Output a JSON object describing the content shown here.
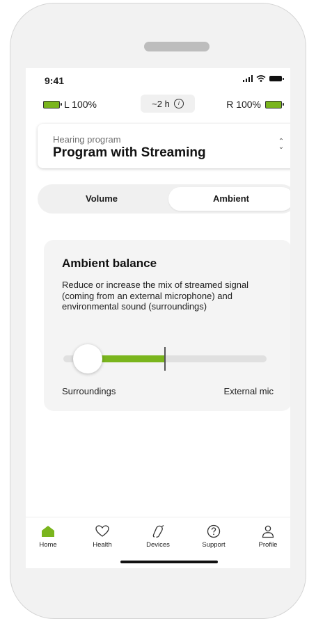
{
  "status_bar": {
    "time": "9:41"
  },
  "battery": {
    "left": "L 100%",
    "right": "R 100%",
    "duration": "~2 h"
  },
  "program": {
    "label": "Hearing program",
    "value": "Program with Streaming"
  },
  "tabs": [
    {
      "label": "Volume",
      "selected": false
    },
    {
      "label": "Ambient",
      "selected": true
    }
  ],
  "ambient": {
    "title": "Ambient balance",
    "description": "Reduce or increase the mix of streamed signal (coming from an external microphone) and environmental sound (surroundings)",
    "slider": {
      "min_label": "Surroundings",
      "max_label": "External mic",
      "value_fraction": 0.12
    }
  },
  "nav": [
    {
      "label": "Home",
      "icon": "home-icon",
      "active": true
    },
    {
      "label": "Health",
      "icon": "heart-icon",
      "active": false
    },
    {
      "label": "Devices",
      "icon": "hearing-aid-icon",
      "active": false
    },
    {
      "label": "Support",
      "icon": "question-icon",
      "active": false
    },
    {
      "label": "Profile",
      "icon": "person-icon",
      "active": false
    }
  ],
  "colors": {
    "accent": "#7ab51d",
    "card_bg": "#f4f4f4",
    "segment_bg": "#f0f0f0"
  }
}
